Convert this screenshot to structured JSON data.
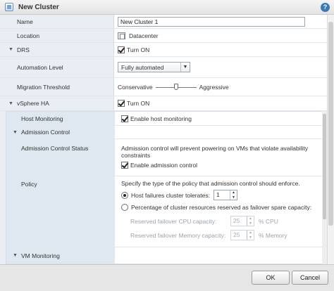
{
  "window": {
    "title": "New Cluster"
  },
  "fields": {
    "name": {
      "label": "Name",
      "value": "New Cluster 1"
    },
    "location": {
      "label": "Location",
      "value": "Datacenter"
    },
    "drs": {
      "label": "DRS",
      "checkbox_label": "Turn ON",
      "checked": true
    },
    "automation_level": {
      "label": "Automation Level",
      "selected": "Fully automated"
    },
    "migration_threshold": {
      "label": "Migration Threshold",
      "left_label": "Conservative",
      "right_label": "Aggressive",
      "level": 0.5
    },
    "vsphere_ha": {
      "label": "vSphere HA",
      "checkbox_label": "Turn ON",
      "checked": true
    }
  },
  "ha": {
    "host_monitoring": {
      "label": "Host Monitoring",
      "checkbox_label": "Enable host monitoring",
      "checked": true
    },
    "admission_control": {
      "label": "Admission Control"
    },
    "admission_status": {
      "label": "Admission Control Status",
      "desc_line1": "Admission control will prevent powering on VMs that violate availability",
      "desc_line2": "constraints",
      "checkbox_label": "Enable admission control",
      "checked": true
    },
    "policy": {
      "label": "Policy",
      "desc": "Specify the type of the policy that admission control should enforce.",
      "option1": "Host failures cluster tolerates:",
      "option1_value": "1",
      "option2": "Percentage of cluster resources reserved as failover spare capacity:",
      "cpu_label": "Reserved failover CPU capacity:",
      "cpu_value": "25",
      "cpu_unit": "% CPU",
      "mem_label": "Reserved failover Memory capacity:",
      "mem_value": "25",
      "mem_unit": "% Memory"
    },
    "vm_monitoring": {
      "label": "VM Monitoring"
    }
  },
  "buttons": {
    "ok": "OK",
    "cancel": "Cancel"
  },
  "icons": {
    "expand": "triangle-down",
    "help": "question-mark"
  },
  "colors": {
    "label_column": "#e9eef5",
    "help": "#3c78b4"
  }
}
